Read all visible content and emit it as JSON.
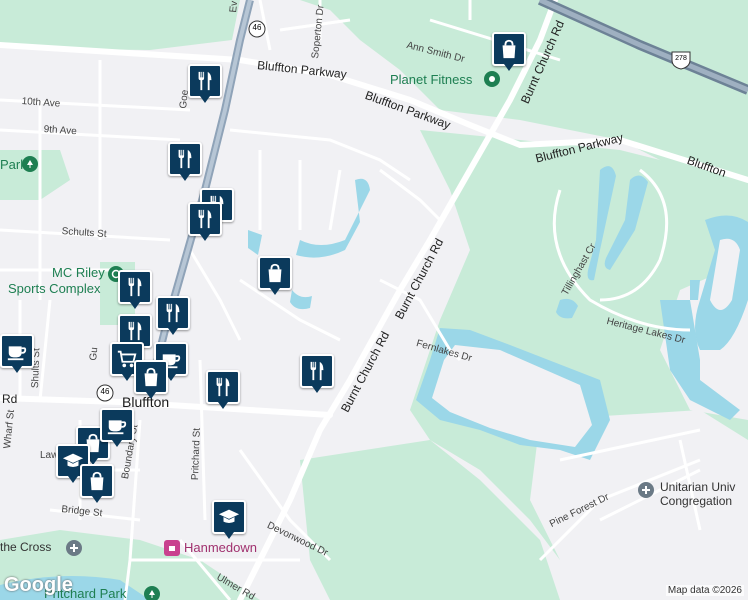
{
  "map": {
    "attribution": "Map data ©2026",
    "logo": "Google"
  },
  "roads": [
    {
      "key": "bluffton_parkway_1",
      "text": "Bluffton Parkway"
    },
    {
      "key": "bluffton_parkway_2",
      "text": "Bluffton Parkway"
    },
    {
      "key": "bluffton_parkway_3",
      "text": "Bluffton Parkway"
    },
    {
      "key": "bluffton_parkway_4",
      "text": "Bluffton"
    },
    {
      "key": "burnt_church_1",
      "text": "Burnt Church Rd"
    },
    {
      "key": "burnt_church_2",
      "text": "Burnt Church Rd"
    },
    {
      "key": "burnt_church_3",
      "text": "Burnt Church Rd"
    },
    {
      "key": "ann_smith",
      "text": "Ann Smith Dr"
    },
    {
      "key": "soperton",
      "text": "Soperton Dr"
    },
    {
      "key": "tenth_ave",
      "text": "10th Ave"
    },
    {
      "key": "ninth_ave",
      "text": "9th Ave"
    },
    {
      "key": "schults",
      "text": "Schults St"
    },
    {
      "key": "shults",
      "text": "Shults St"
    },
    {
      "key": "fernlakes",
      "text": "Fernlakes Dr"
    },
    {
      "key": "tillinghast",
      "text": "Tillinghast Cr"
    },
    {
      "key": "heritage_lakes",
      "text": "Heritage Lakes Dr"
    },
    {
      "key": "wharf",
      "text": "Wharf St"
    },
    {
      "key": "pritchard",
      "text": "Pritchard St"
    },
    {
      "key": "boundary",
      "text": "Boundary St"
    },
    {
      "key": "bridge",
      "text": "Bridge St"
    },
    {
      "key": "devonwood",
      "text": "Devonwood Dr"
    },
    {
      "key": "pine_forest",
      "text": "Pine Forest Dr"
    },
    {
      "key": "ulmer",
      "text": "Ulmer Rd"
    },
    {
      "key": "rd_left",
      "text": "Rd"
    },
    {
      "key": "ev",
      "text": "Ev"
    },
    {
      "key": "goe",
      "text": "Goe"
    },
    {
      "key": "law",
      "text": "Law"
    },
    {
      "key": "gui",
      "text": "Gu"
    }
  ],
  "places": [
    {
      "key": "planet_fitness",
      "text": "Planet Fitness"
    },
    {
      "key": "mc_riley",
      "text": "MC Riley"
    },
    {
      "key": "sports_complex",
      "text": "Sports Complex"
    },
    {
      "key": "bluffton",
      "text": "Bluffton"
    },
    {
      "key": "unitarian_1",
      "text": "Unitarian Univ"
    },
    {
      "key": "unitarian_2",
      "text": "Congregation"
    },
    {
      "key": "hanmedown",
      "text": "Hanmedown"
    },
    {
      "key": "cross",
      "text": "the Cross"
    },
    {
      "key": "park",
      "text": "Park"
    },
    {
      "key": "pritchard_park",
      "text": "Pritchard Park"
    }
  ],
  "shields": [
    {
      "key": "sc46_top",
      "text": "46"
    },
    {
      "key": "us278",
      "text": "278"
    },
    {
      "key": "sc46_bottom",
      "text": "46"
    }
  ],
  "colors": {
    "water": "#9bd7e8",
    "green": "#c8ebd8",
    "land": "#f1f1f4",
    "road": "#ffffff",
    "highway": "#8fa3b8",
    "marker": "#0b3a5c"
  },
  "markers": [
    {
      "key": "m1",
      "icon": "shopping-bag-icon"
    },
    {
      "key": "m2",
      "icon": "fork-knife-icon"
    },
    {
      "key": "m3",
      "icon": "fork-knife-icon"
    },
    {
      "key": "m4",
      "icon": "fork-knife-icon"
    },
    {
      "key": "m5",
      "icon": "fork-knife-icon"
    },
    {
      "key": "m6",
      "icon": "shopping-bag-icon"
    },
    {
      "key": "m7",
      "icon": "fork-knife-icon"
    },
    {
      "key": "m8",
      "icon": "fork-knife-icon"
    },
    {
      "key": "m9",
      "icon": "fork-knife-icon"
    },
    {
      "key": "m10",
      "icon": "coffee-cup-icon"
    },
    {
      "key": "m11",
      "icon": "shopping-cart-icon"
    },
    {
      "key": "m12",
      "icon": "coffee-cup-icon"
    },
    {
      "key": "m13",
      "icon": "shopping-bag-icon"
    },
    {
      "key": "m14",
      "icon": "fork-knife-icon"
    },
    {
      "key": "m15",
      "icon": "fork-knife-icon"
    },
    {
      "key": "m16",
      "icon": "shopping-bag-icon"
    },
    {
      "key": "m17",
      "icon": "graduation-cap-icon"
    },
    {
      "key": "m18",
      "icon": "shopping-bag-icon"
    },
    {
      "key": "m19",
      "icon": "graduation-cap-icon"
    },
    {
      "key": "m20",
      "icon": "coffee-cup-icon"
    }
  ]
}
